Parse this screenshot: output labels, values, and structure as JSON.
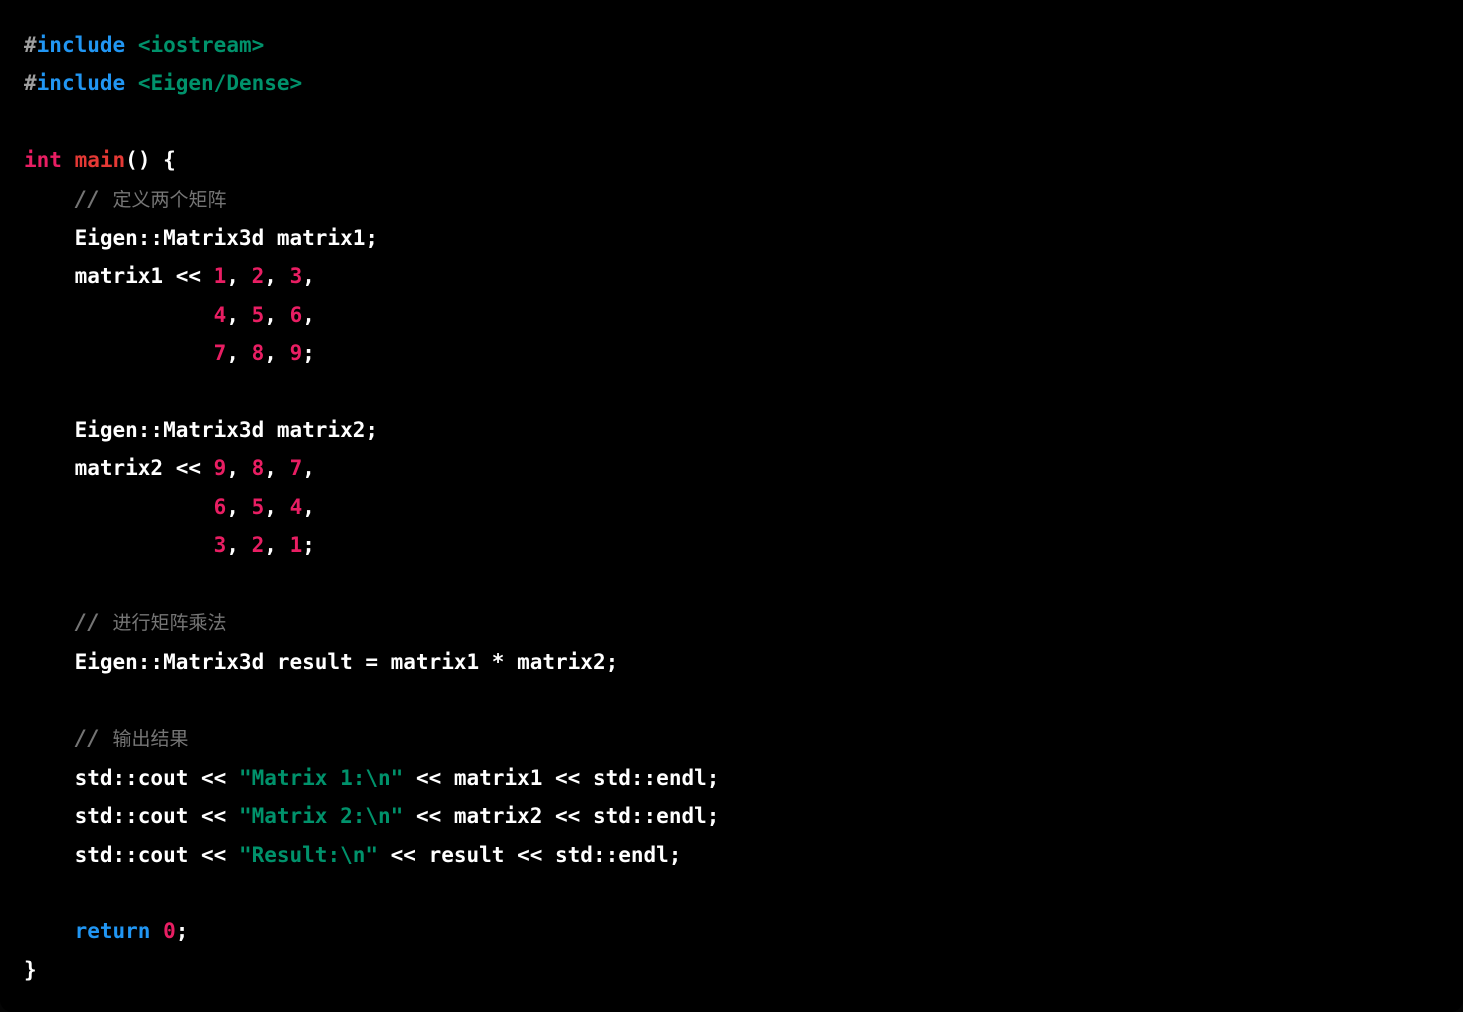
{
  "editor": {
    "language": "cpp",
    "background_color": "#000000",
    "default_text_color": "#ffffff",
    "font_size_px": 21,
    "line_height_px": 38.4
  },
  "theme_colors": {
    "preprocessor_hash": "#9e9e9e",
    "keyword": "#2196F3",
    "header_include": "#00926b",
    "type": "#E91E63",
    "function": "#E53935",
    "number": "#E91E63",
    "string": "#00926b",
    "comment": "#757575",
    "plain": "#ffffff"
  },
  "code": {
    "lines": [
      {
        "n": 1,
        "tokens": [
          {
            "t": "pre",
            "v": "#"
          },
          {
            "t": "kw",
            "v": "include"
          },
          {
            "t": "plain",
            "v": " "
          },
          {
            "t": "hdr",
            "v": "<iostream>"
          }
        ]
      },
      {
        "n": 2,
        "tokens": [
          {
            "t": "pre",
            "v": "#"
          },
          {
            "t": "kw",
            "v": "include"
          },
          {
            "t": "plain",
            "v": " "
          },
          {
            "t": "hdr",
            "v": "<Eigen/Dense>"
          }
        ]
      },
      {
        "n": 3,
        "tokens": []
      },
      {
        "n": 4,
        "tokens": [
          {
            "t": "type",
            "v": "int"
          },
          {
            "t": "plain",
            "v": " "
          },
          {
            "t": "fn",
            "v": "main"
          },
          {
            "t": "plain",
            "v": "() {"
          }
        ]
      },
      {
        "n": 5,
        "tokens": [
          {
            "t": "cmt",
            "v": "    // 定义两个矩阵"
          }
        ]
      },
      {
        "n": 6,
        "tokens": [
          {
            "t": "plain",
            "v": "    Eigen::Matrix3d matrix1;"
          }
        ]
      },
      {
        "n": 7,
        "tokens": [
          {
            "t": "plain",
            "v": "    matrix1 << "
          },
          {
            "t": "num",
            "v": "1"
          },
          {
            "t": "plain",
            "v": ", "
          },
          {
            "t": "num",
            "v": "2"
          },
          {
            "t": "plain",
            "v": ", "
          },
          {
            "t": "num",
            "v": "3"
          },
          {
            "t": "plain",
            "v": ","
          }
        ]
      },
      {
        "n": 8,
        "tokens": [
          {
            "t": "plain",
            "v": "               "
          },
          {
            "t": "num",
            "v": "4"
          },
          {
            "t": "plain",
            "v": ", "
          },
          {
            "t": "num",
            "v": "5"
          },
          {
            "t": "plain",
            "v": ", "
          },
          {
            "t": "num",
            "v": "6"
          },
          {
            "t": "plain",
            "v": ","
          }
        ]
      },
      {
        "n": 9,
        "tokens": [
          {
            "t": "plain",
            "v": "               "
          },
          {
            "t": "num",
            "v": "7"
          },
          {
            "t": "plain",
            "v": ", "
          },
          {
            "t": "num",
            "v": "8"
          },
          {
            "t": "plain",
            "v": ", "
          },
          {
            "t": "num",
            "v": "9"
          },
          {
            "t": "plain",
            "v": ";"
          }
        ]
      },
      {
        "n": 10,
        "tokens": []
      },
      {
        "n": 11,
        "tokens": [
          {
            "t": "plain",
            "v": "    Eigen::Matrix3d matrix2;"
          }
        ]
      },
      {
        "n": 12,
        "tokens": [
          {
            "t": "plain",
            "v": "    matrix2 << "
          },
          {
            "t": "num",
            "v": "9"
          },
          {
            "t": "plain",
            "v": ", "
          },
          {
            "t": "num",
            "v": "8"
          },
          {
            "t": "plain",
            "v": ", "
          },
          {
            "t": "num",
            "v": "7"
          },
          {
            "t": "plain",
            "v": ","
          }
        ]
      },
      {
        "n": 13,
        "tokens": [
          {
            "t": "plain",
            "v": "               "
          },
          {
            "t": "num",
            "v": "6"
          },
          {
            "t": "plain",
            "v": ", "
          },
          {
            "t": "num",
            "v": "5"
          },
          {
            "t": "plain",
            "v": ", "
          },
          {
            "t": "num",
            "v": "4"
          },
          {
            "t": "plain",
            "v": ","
          }
        ]
      },
      {
        "n": 14,
        "tokens": [
          {
            "t": "plain",
            "v": "               "
          },
          {
            "t": "num",
            "v": "3"
          },
          {
            "t": "plain",
            "v": ", "
          },
          {
            "t": "num",
            "v": "2"
          },
          {
            "t": "plain",
            "v": ", "
          },
          {
            "t": "num",
            "v": "1"
          },
          {
            "t": "plain",
            "v": ";"
          }
        ]
      },
      {
        "n": 15,
        "tokens": []
      },
      {
        "n": 16,
        "tokens": [
          {
            "t": "cmt",
            "v": "    // 进行矩阵乘法"
          }
        ]
      },
      {
        "n": 17,
        "tokens": [
          {
            "t": "plain",
            "v": "    Eigen::Matrix3d result = matrix1 * matrix2;"
          }
        ]
      },
      {
        "n": 18,
        "tokens": []
      },
      {
        "n": 19,
        "tokens": [
          {
            "t": "cmt",
            "v": "    // 输出结果"
          }
        ]
      },
      {
        "n": 20,
        "tokens": [
          {
            "t": "plain",
            "v": "    std::cout << "
          },
          {
            "t": "str",
            "v": "\"Matrix 1:\\n\""
          },
          {
            "t": "plain",
            "v": " << matrix1 << std::endl;"
          }
        ]
      },
      {
        "n": 21,
        "tokens": [
          {
            "t": "plain",
            "v": "    std::cout << "
          },
          {
            "t": "str",
            "v": "\"Matrix 2:\\n\""
          },
          {
            "t": "plain",
            "v": " << matrix2 << std::endl;"
          }
        ]
      },
      {
        "n": 22,
        "tokens": [
          {
            "t": "plain",
            "v": "    std::cout << "
          },
          {
            "t": "str",
            "v": "\"Result:\\n\""
          },
          {
            "t": "plain",
            "v": " << result << std::endl;"
          }
        ]
      },
      {
        "n": 23,
        "tokens": []
      },
      {
        "n": 24,
        "tokens": [
          {
            "t": "plain",
            "v": "    "
          },
          {
            "t": "kw",
            "v": "return"
          },
          {
            "t": "plain",
            "v": " "
          },
          {
            "t": "num",
            "v": "0"
          },
          {
            "t": "plain",
            "v": ";"
          }
        ]
      },
      {
        "n": 25,
        "tokens": [
          {
            "t": "plain",
            "v": "}"
          }
        ]
      }
    ]
  }
}
